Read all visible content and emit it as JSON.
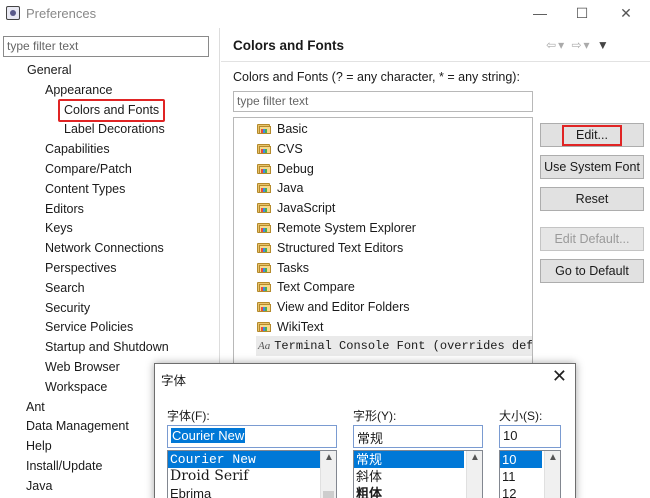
{
  "window": {
    "title": "Preferences",
    "minimize_glyph": "—",
    "maximize_glyph": "☐",
    "close_glyph": "✕"
  },
  "left": {
    "filter_placeholder": "type filter text",
    "tree": [
      {
        "label": "General",
        "level": 1
      },
      {
        "label": "Appearance",
        "level": 2
      },
      {
        "label": "Colors and Fonts",
        "level": 3,
        "selected": true
      },
      {
        "label": "Label Decorations",
        "level": 3
      },
      {
        "label": "Capabilities",
        "level": 2
      },
      {
        "label": "Compare/Patch",
        "level": 2
      },
      {
        "label": "Content Types",
        "level": 2
      },
      {
        "label": "Editors",
        "level": 2
      },
      {
        "label": "Keys",
        "level": 2
      },
      {
        "label": "Network Connections",
        "level": 2
      },
      {
        "label": "Perspectives",
        "level": 2
      },
      {
        "label": "Search",
        "level": 2
      },
      {
        "label": "Security",
        "level": 2
      },
      {
        "label": "Service Policies",
        "level": 2
      },
      {
        "label": "Startup and Shutdown",
        "level": 2
      },
      {
        "label": "Web Browser",
        "level": 2
      },
      {
        "label": "Workspace",
        "level": 2
      },
      {
        "label": "Ant",
        "level": 0
      },
      {
        "label": "Data Management",
        "level": 0
      },
      {
        "label": "Help",
        "level": 0
      },
      {
        "label": "Install/Update",
        "level": 0
      },
      {
        "label": "Java",
        "level": 0
      }
    ]
  },
  "right": {
    "title": "Colors and Fonts",
    "description": "Colors and Fonts (? = any character, * = any string):",
    "filter_placeholder": "type filter text",
    "categories": [
      "Basic",
      "CVS",
      "Debug",
      "Java",
      "JavaScript",
      "Remote System Explorer",
      "Structured Text Editors",
      "Tasks",
      "Text Compare",
      "View and Editor Folders",
      "WikiText"
    ],
    "font_entry": {
      "icon_text": "Aa",
      "label": "Terminal Console Font (overrides default: Text Font)"
    },
    "buttons": {
      "edit": "Edit...",
      "use_system_font": "Use System Font",
      "reset": "Reset",
      "edit_default": "Edit Default...",
      "go_to_default": "Go to Default"
    }
  },
  "font_dialog": {
    "title": "字体",
    "close_glyph": "✕",
    "font_label": "字体(F):",
    "style_label": "字形(Y):",
    "size_label": "大小(S):",
    "font_value": "Courier New",
    "style_value": "常规",
    "size_value": "10",
    "font_options": [
      "Courier New",
      "Droid Serif",
      "Ebrima"
    ],
    "style_options": [
      "常规",
      "斜体",
      "粗体"
    ],
    "size_options": [
      "10",
      "11",
      "12"
    ]
  },
  "colors": {
    "highlight_red": "#e02424",
    "selection_blue": "#0078d7"
  }
}
